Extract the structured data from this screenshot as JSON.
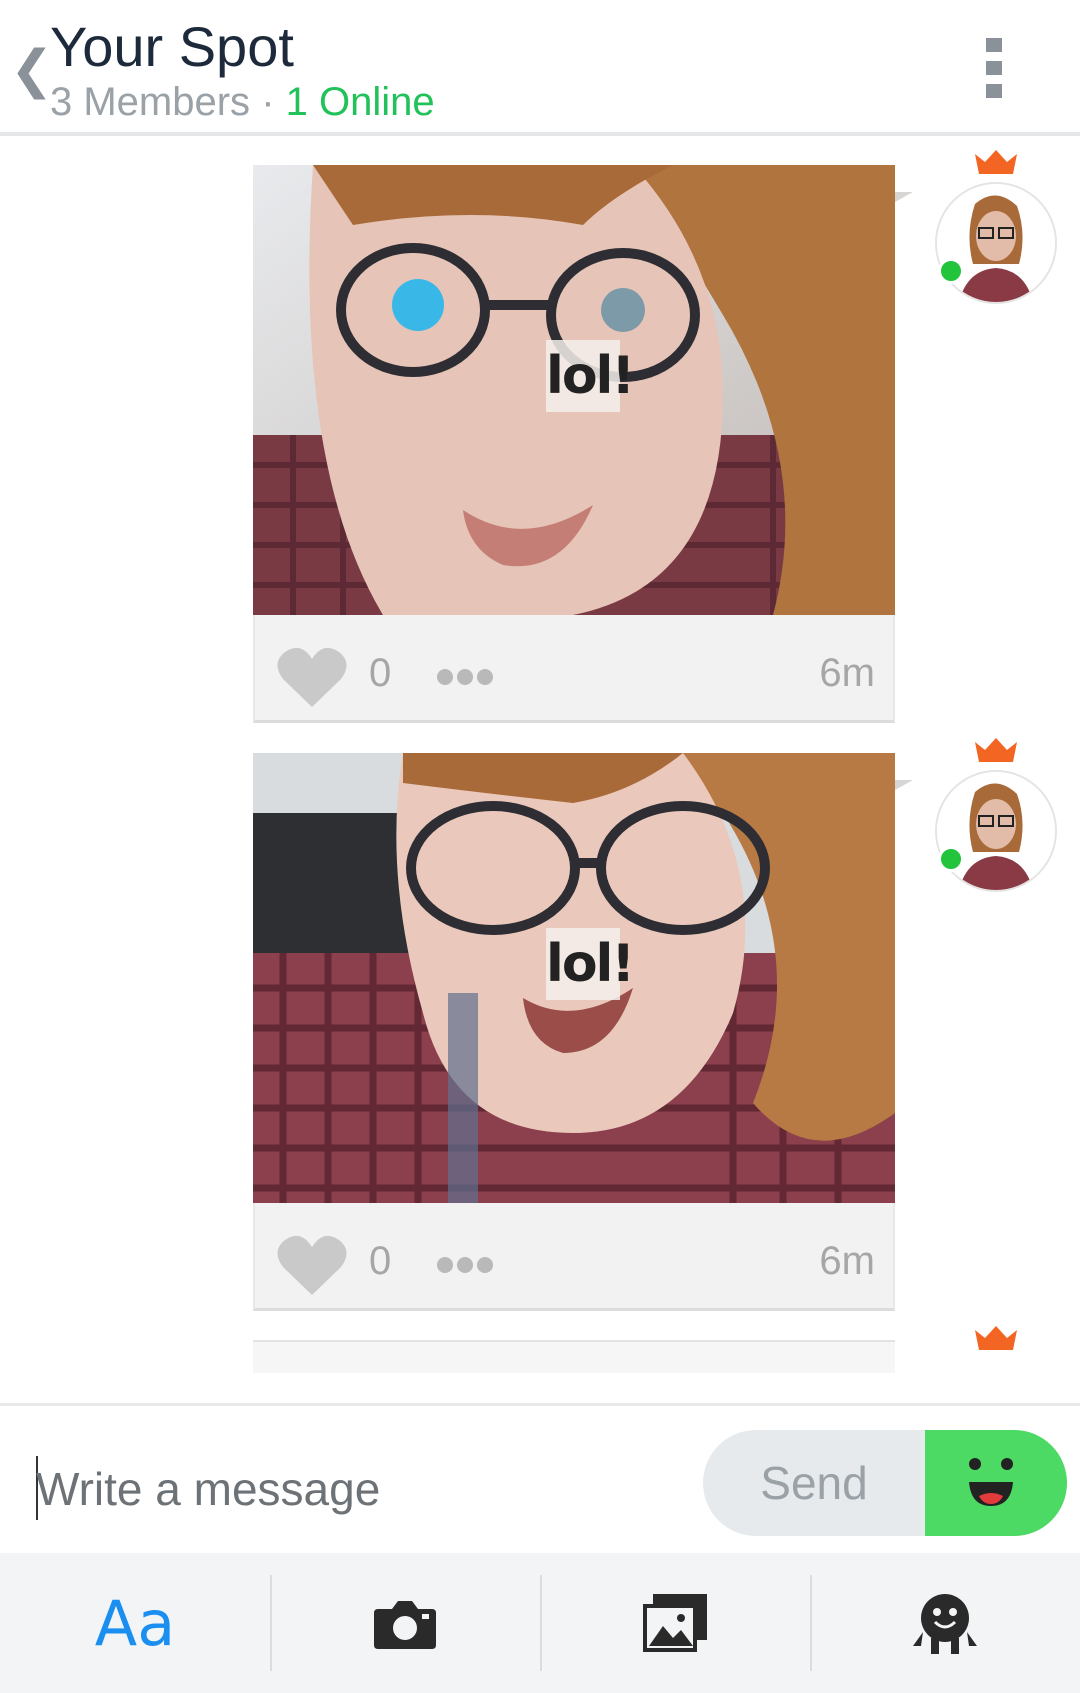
{
  "header": {
    "back_icon": "chevron-left-icon",
    "title": "Your Spot",
    "members": "3 Members",
    "separator": "·",
    "online": "1 Online",
    "menu_icon": "overflow-menu-icon"
  },
  "posts": [
    {
      "caption": "lol!",
      "likes": "0",
      "time": "6m"
    },
    {
      "caption": "lol!",
      "likes": "0",
      "time": "6m"
    }
  ],
  "composer": {
    "placeholder": "Write a message",
    "send_label": "Send"
  },
  "toolbar": {
    "text_label": "Aa",
    "items": [
      "text-format-icon",
      "camera-icon",
      "gallery-icon",
      "stickers-icon"
    ]
  },
  "colors": {
    "online": "#21c25a",
    "accent": "#1a8ff0",
    "emoji_button": "#4cd964",
    "crown": "#f26522"
  }
}
